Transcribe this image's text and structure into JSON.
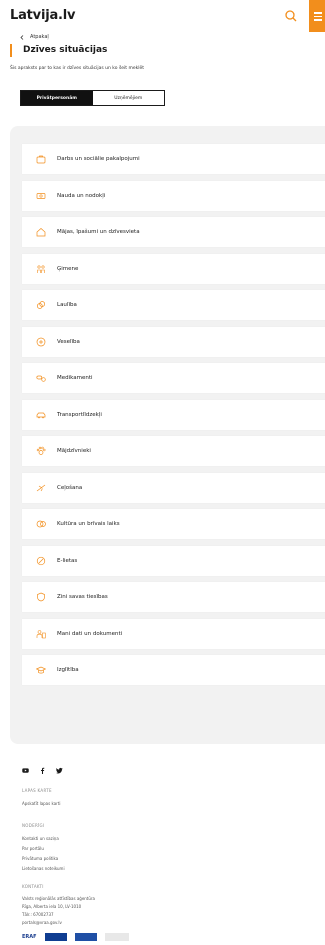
{
  "header": {
    "logo_text": "Latvija.lv",
    "search_icon": "search-icon",
    "menu_icon": "menu-icon",
    "accent": "#f28e1c"
  },
  "back_link": "Atpakaļ",
  "page": {
    "title": "Dzīves situācijas",
    "subtitle": "Šis apraksts par to kas ir dzīves situācijas un ko šeit meklēt"
  },
  "tabs": [
    {
      "label": "Privātpersonām",
      "active": true
    },
    {
      "label": "Uzņēmējiem",
      "active": false
    }
  ],
  "situations": [
    {
      "label": "Darbs un sociālie pakalpojumi",
      "icon": "briefcase-icon"
    },
    {
      "label": "Nauda un nodokļi",
      "icon": "money-icon"
    },
    {
      "label": "Mājas, īpašumi un dzīvesvieta",
      "icon": "house-icon"
    },
    {
      "label": "Ģimene",
      "icon": "family-icon"
    },
    {
      "label": "Laulība",
      "icon": "rings-icon"
    },
    {
      "label": "Veselība",
      "icon": "health-icon"
    },
    {
      "label": "Medikamenti",
      "icon": "pills-icon"
    },
    {
      "label": "Transportlīdzekļi",
      "icon": "car-icon"
    },
    {
      "label": "Mājdzīvnieki",
      "icon": "paw-icon"
    },
    {
      "label": "Ceļošana",
      "icon": "plane-icon"
    },
    {
      "label": "Kultūra un brīvais laiks",
      "icon": "culture-icon"
    },
    {
      "label": "E-lietas",
      "icon": "e-services-icon"
    },
    {
      "label": "Zini savas tiesības",
      "icon": "shield-icon"
    },
    {
      "label": "Mani dati un dokumenti",
      "icon": "documents-icon"
    },
    {
      "label": "Izglītība",
      "icon": "graduation-icon"
    }
  ],
  "footer": {
    "social": [
      "youtube-icon",
      "facebook-icon",
      "twitter-icon"
    ],
    "sitemap_heading": "LAPAS KARTE",
    "sitemap_link": "Apskatīt lapas karti",
    "useful_heading": "NODERĪGI",
    "useful_links": [
      "Kontakti un saziņa",
      "Par portālu",
      "Privātuma politika",
      "Lietošanas noteikumi"
    ],
    "contacts_heading": "KONTAKTI",
    "contacts_lines": [
      "Valsts reģionālās attīstības aģentūra",
      "Rīga, Alberta iela 10, LV-1010",
      "Tālr.: 67002737",
      "portals@vraa.gov.lv"
    ],
    "logos": [
      "ERAF"
    ]
  }
}
